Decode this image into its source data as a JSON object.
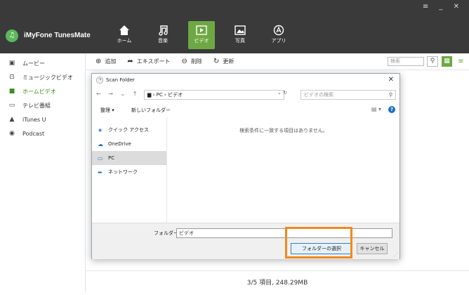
{
  "app": {
    "name": "iMyFone TunesMate",
    "window_controls": "≡ _ ✕"
  },
  "nav": [
    {
      "label": "ホーム",
      "icon": "home-icon"
    },
    {
      "label": "音楽",
      "icon": "music-icon"
    },
    {
      "label": "ビデオ",
      "icon": "video-icon",
      "active": true
    },
    {
      "label": "写真",
      "icon": "photo-icon"
    },
    {
      "label": "アプリ",
      "icon": "apps-icon"
    }
  ],
  "sidebar": {
    "items": [
      {
        "label": "ムービー",
        "icon": "movie-icon"
      },
      {
        "label": "ミュージックビデオ",
        "icon": "music-video-icon"
      },
      {
        "label": "ホームビデオ",
        "icon": "home-video-icon",
        "active": true
      },
      {
        "label": "テレビ番組",
        "icon": "tv-icon"
      },
      {
        "label": "iTunes U",
        "icon": "graduation-icon"
      },
      {
        "label": "Podcast",
        "icon": "podcast-icon"
      }
    ]
  },
  "toolbar": {
    "add": "追加",
    "export": "エキスポート",
    "delete": "削除",
    "refresh": "更新",
    "search_placeholder": "検索"
  },
  "status": "3/5 項目, 248.29MB",
  "dialog": {
    "title": "Scan Folder",
    "path": "PC › ビデオ",
    "search_placeholder": "ビデオの検索",
    "organize": "整理 ▾",
    "new_folder": "新しいフォルダー",
    "nav_items": [
      {
        "label": "クイック アクセス",
        "icon": "star-icon"
      },
      {
        "label": "OneDrive",
        "icon": "cloud-icon"
      },
      {
        "label": "PC",
        "icon": "computer-icon",
        "selected": true
      },
      {
        "label": "ネットワーク",
        "icon": "network-icon"
      }
    ],
    "empty_message": "検索条件に一致する項目はありません。",
    "folder_label": "フォルダー:",
    "folder_value": "ビデオ",
    "select_button": "フォルダーの選択",
    "cancel_button": "キャンセル"
  },
  "colors": {
    "accent": "#6ea843",
    "topbar": "#3a3a3a",
    "highlight": "#f08a1c"
  }
}
